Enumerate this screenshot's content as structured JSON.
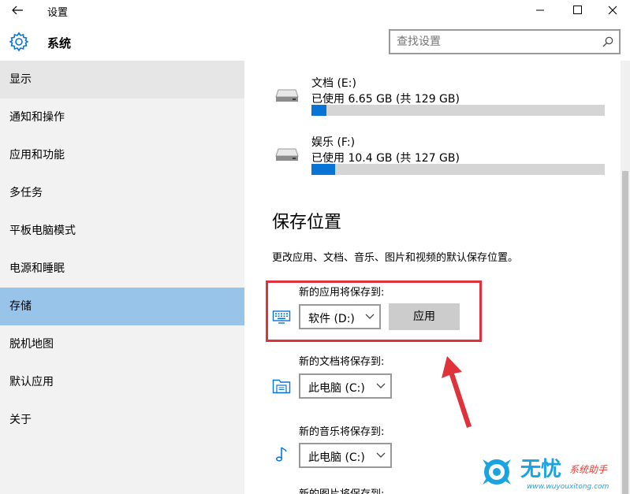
{
  "window": {
    "title": "设置",
    "controls": {
      "minimize": "minimize-icon",
      "maximize": "maximize-icon",
      "close": "close-icon"
    }
  },
  "header": {
    "section_title": "系统",
    "search_placeholder": "查找设置"
  },
  "sidebar": {
    "items": [
      {
        "label": "显示",
        "state": "hover"
      },
      {
        "label": "通知和操作",
        "state": "normal"
      },
      {
        "label": "应用和功能",
        "state": "normal"
      },
      {
        "label": "多任务",
        "state": "normal"
      },
      {
        "label": "平板电脑模式",
        "state": "normal"
      },
      {
        "label": "电源和睡眠",
        "state": "normal"
      },
      {
        "label": "存储",
        "state": "selected"
      },
      {
        "label": "脱机地图",
        "state": "normal"
      },
      {
        "label": "默认应用",
        "state": "normal"
      },
      {
        "label": "关于",
        "state": "normal"
      }
    ]
  },
  "drives": [
    {
      "name": "文档 (E:)",
      "usage": "已使用 6.65 GB (共 129 GB)",
      "used_fraction": 0.0516
    },
    {
      "name": "娱乐 (F:)",
      "usage": "已使用 10.4 GB (共 127 GB)",
      "used_fraction": 0.0819
    }
  ],
  "save_locations": {
    "heading": "保存位置",
    "description": "更改应用、文档、音乐、图片和视频的默认保存位置。",
    "apps": {
      "label": "新的应用将保存到:",
      "selected": "软件 (D:)",
      "apply_label": "应用"
    },
    "documents": {
      "label": "新的文档将保存到:",
      "selected": "此电脑 (C:)"
    },
    "music": {
      "label": "新的音乐将保存到:",
      "selected": "此电脑 (C:)"
    },
    "next_label_clipped": "新的图片将保存到:"
  },
  "watermark": {
    "brand": "无忧",
    "slogan": "系统助手",
    "url": "www.wuyouxitong.com"
  },
  "colors": {
    "accent": "#0a74d4",
    "sidebar_bg": "#f2f2f2",
    "sidebar_selected": "#99c4ea",
    "annotation_red": "#e0323a"
  }
}
